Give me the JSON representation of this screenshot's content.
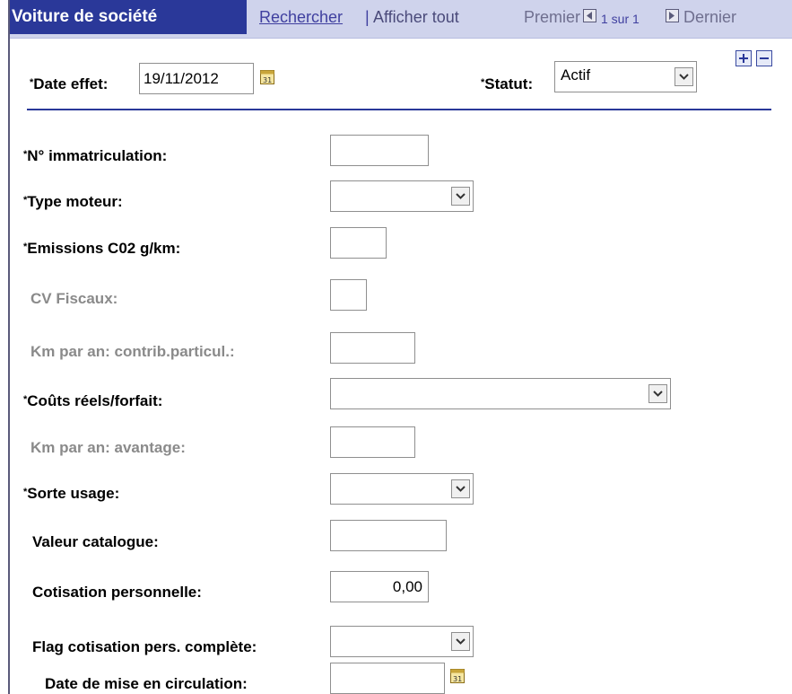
{
  "header": {
    "title": "Voiture de société",
    "search_link": "Rechercher",
    "separator": "|",
    "show_all": "Afficher tout",
    "first": "Premier",
    "page_num": "1 sur 1",
    "last": "Dernier"
  },
  "top": {
    "date_label": "Date effet:",
    "date_value": "19/11/2012",
    "status_label": "Statut:",
    "status_value": "Actif"
  },
  "required_marker": "*",
  "fields": {
    "immatriculation": {
      "label": "N° immatriculation:",
      "value": ""
    },
    "type_moteur": {
      "label": "Type moteur:",
      "value": ""
    },
    "emissions": {
      "label": "Emissions C02 g/km:",
      "value": ""
    },
    "cv_fiscaux": {
      "label": "CV Fiscaux:",
      "value": ""
    },
    "km_contrib": {
      "label": "Km par an: contrib.particul.:",
      "value": ""
    },
    "couts": {
      "label": "Coûts réels/forfait:",
      "value": ""
    },
    "km_avantage": {
      "label": "Km par an: avantage:",
      "value": ""
    },
    "sorte_usage": {
      "label": "Sorte usage:",
      "value": ""
    },
    "valeur_catalogue": {
      "label": "Valeur catalogue:",
      "value": ""
    },
    "cotisation": {
      "label": "Cotisation personnelle:",
      "value": "0,00"
    },
    "flag_cotisation": {
      "label": "Flag cotisation pers. complète:",
      "value": ""
    },
    "date_circulation": {
      "label": "Date de mise en circulation:",
      "value": ""
    }
  },
  "icons": {
    "calendar_text": "31",
    "colors": {
      "header_dark": "#2a3899",
      "header_light": "#cfd3ec",
      "link": "#3f3f9f",
      "disabled_label": "#8a8a8a"
    }
  }
}
